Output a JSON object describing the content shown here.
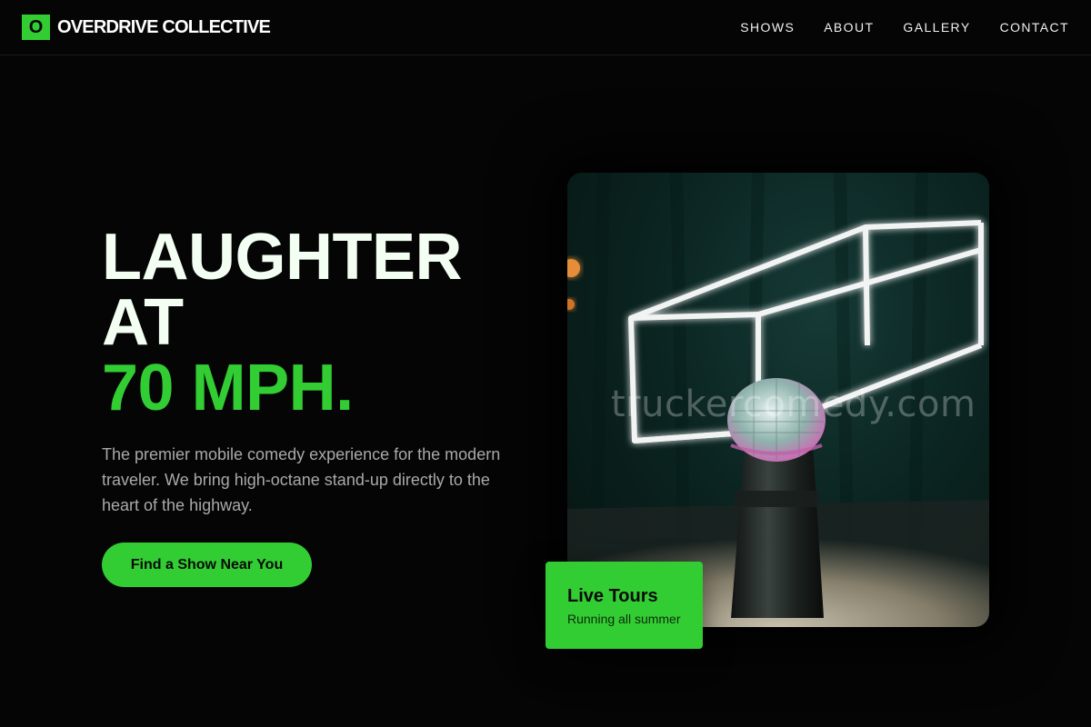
{
  "brand": {
    "mark": "O",
    "name": "OVERDRIVE COLLECTIVE",
    "accent_color": "#32cd32",
    "background_color": "#050505"
  },
  "nav": {
    "items": [
      {
        "label": "SHOWS"
      },
      {
        "label": "ABOUT"
      },
      {
        "label": "GALLERY"
      },
      {
        "label": "CONTACT"
      }
    ]
  },
  "hero": {
    "title_line1": "LAUGHTER",
    "title_line2": "AT",
    "title_accent": "70 MPH.",
    "description": "The premier mobile comedy experience for the modern traveler. We bring high-octane stand-up directly to the heart of the highway.",
    "cta_label": "Find a Show Near You"
  },
  "photo": {
    "subject": "microphone-neon-stage",
    "watermark": "truckercomedy.com"
  },
  "badge": {
    "title": "Live Tours",
    "subtitle": "Running all summer"
  }
}
